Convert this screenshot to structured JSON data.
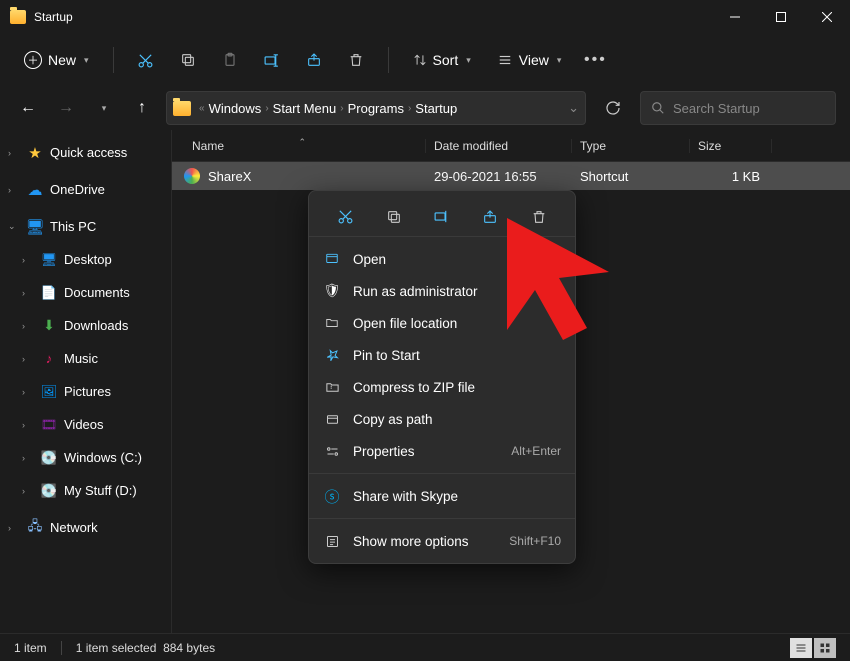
{
  "window": {
    "title": "Startup"
  },
  "toolbar": {
    "new_label": "New",
    "sort_label": "Sort",
    "view_label": "View"
  },
  "breadcrumb": [
    "Windows",
    "Start Menu",
    "Programs",
    "Startup"
  ],
  "search": {
    "placeholder": "Search Startup"
  },
  "sidebar": {
    "quick_access": "Quick access",
    "onedrive": "OneDrive",
    "this_pc": "This PC",
    "desktop": "Desktop",
    "documents": "Documents",
    "downloads": "Downloads",
    "music": "Music",
    "pictures": "Pictures",
    "videos": "Videos",
    "windows_c": "Windows (C:)",
    "my_stuff_d": "My Stuff (D:)",
    "network": "Network"
  },
  "columns": {
    "name": "Name",
    "date": "Date modified",
    "type": "Type",
    "size": "Size"
  },
  "files": [
    {
      "name": "ShareX",
      "date": "29-06-2021 16:55",
      "type": "Shortcut",
      "size": "1 KB"
    }
  ],
  "context_menu": {
    "open": "Open",
    "run_admin": "Run as administrator",
    "open_location": "Open file location",
    "pin_start": "Pin to Start",
    "compress": "Compress to ZIP file",
    "copy_path": "Copy as path",
    "properties": "Properties",
    "properties_sc": "Alt+Enter",
    "share_skype": "Share with Skype",
    "show_more": "Show more options",
    "show_more_sc": "Shift+F10"
  },
  "status": {
    "count": "1 item",
    "selected": "1 item selected",
    "size": "884 bytes"
  }
}
